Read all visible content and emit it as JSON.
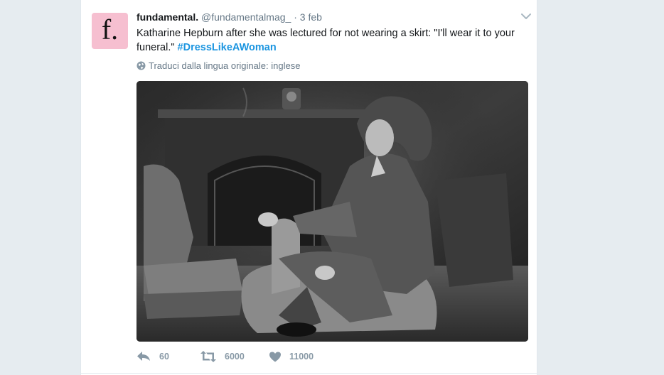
{
  "tweet": {
    "avatar_letter": "f.",
    "fullname": "fundamental.",
    "username": "@fundamentalmag_",
    "separator": "·",
    "time": "3 feb",
    "text": "Katharine Hepburn after she was lectured for not wearing a skirt: \"I'll wear it to your funeral.\" ",
    "hashtag": "#DressLikeAWoman",
    "translate_label": "Traduci dalla lingua originale: inglese",
    "actions": {
      "reply_count": "60",
      "retweet_count": "6000",
      "like_count": "11000"
    }
  },
  "colors": {
    "background": "#e6ecf0",
    "card": "#ffffff",
    "avatar_bg": "#f6bfd0",
    "link": "#1b95e0",
    "muted": "#657786",
    "icon": "#8899a6"
  },
  "icons": [
    "chevron-down-icon",
    "globe-icon",
    "reply-icon",
    "retweet-icon",
    "heart-icon"
  ]
}
